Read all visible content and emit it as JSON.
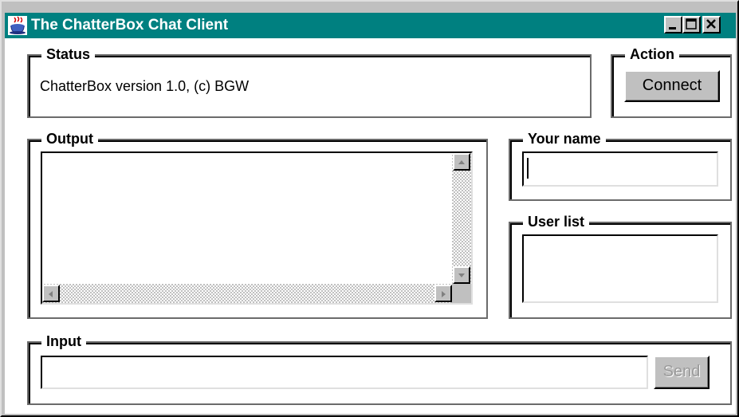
{
  "window": {
    "title": "The ChatterBox Chat Client",
    "controls": [
      "minimize-icon",
      "maximize-icon",
      "close-icon"
    ]
  },
  "status": {
    "legend": "Status",
    "text": "ChatterBox version 1.0, (c) BGW"
  },
  "action": {
    "legend": "Action",
    "connect_label": "Connect"
  },
  "output": {
    "legend": "Output",
    "text": ""
  },
  "your_name": {
    "legend": "Your name",
    "value": ""
  },
  "user_list": {
    "legend": "User list",
    "items": []
  },
  "input": {
    "legend": "Input",
    "value": "",
    "send_label": "Send",
    "send_enabled": false
  },
  "colors": {
    "titlebar": "#008080",
    "face": "#c0c0c0",
    "background": "#ffffff"
  }
}
